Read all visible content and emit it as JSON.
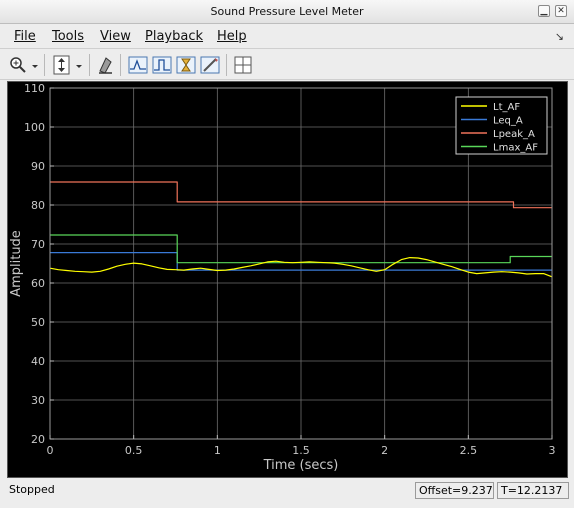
{
  "window": {
    "title": "Sound Pressure Level Meter"
  },
  "menu": [
    {
      "key": "file",
      "label": "File"
    },
    {
      "key": "tools",
      "label": "Tools"
    },
    {
      "key": "view",
      "label": "View"
    },
    {
      "key": "playback",
      "label": "Playback"
    },
    {
      "key": "help",
      "label": "Help"
    }
  ],
  "toolbar": {
    "icons": [
      "zoom-in-icon",
      "dropdown-arrow-icon",
      "autoscale-icon",
      "dropdown-arrow-icon",
      "highlight-icon",
      "triggers-icon",
      "peak-finder-icon",
      "bilevel-measurements-icon",
      "signal-statistics-icon",
      "legend-layout-icon"
    ]
  },
  "status": {
    "state": "Stopped",
    "offset": "Offset=9.237",
    "time": "T=12.2137"
  },
  "colors": {
    "background": "#000000",
    "grid": "#6e6e6e",
    "axis_text": "#c8c8c8",
    "Lt_AF": "#ffff00",
    "Leq_A": "#3a7ad6",
    "Lpeak_A": "#f0735a",
    "Lmax_AF": "#59d659"
  },
  "chart_data": {
    "type": "line",
    "xlabel": "Time (secs)",
    "ylabel": "Amplitude",
    "xlim": [
      0,
      3
    ],
    "ylim": [
      20,
      110
    ],
    "xticks": [
      "0",
      "0.5",
      "1",
      "1.5",
      "2",
      "2.5",
      "3"
    ],
    "yticks": [
      "20",
      "30",
      "40",
      "50",
      "60",
      "70",
      "80",
      "90",
      "100",
      "110"
    ],
    "grid": true,
    "legend_position": "top-right",
    "series": [
      {
        "name": "Lt_AF",
        "color": "#ffff00",
        "x": [
          0,
          0.05,
          0.1,
          0.15,
          0.2,
          0.25,
          0.3,
          0.35,
          0.4,
          0.45,
          0.5,
          0.55,
          0.6,
          0.65,
          0.7,
          0.75,
          0.8,
          0.85,
          0.9,
          0.95,
          1.0,
          1.05,
          1.1,
          1.15,
          1.2,
          1.25,
          1.3,
          1.35,
          1.4,
          1.45,
          1.5,
          1.55,
          1.6,
          1.65,
          1.7,
          1.75,
          1.8,
          1.85,
          1.9,
          1.95,
          2.0,
          2.05,
          2.1,
          2.15,
          2.2,
          2.25,
          2.3,
          2.35,
          2.4,
          2.45,
          2.5,
          2.55,
          2.6,
          2.65,
          2.7,
          2.75,
          2.8,
          2.85,
          2.9,
          2.95,
          3.0
        ],
        "y": [
          63.8,
          63.4,
          63.2,
          63.0,
          62.9,
          62.8,
          63.0,
          63.6,
          64.3,
          64.8,
          65.1,
          64.9,
          64.4,
          63.9,
          63.5,
          63.4,
          63.3,
          63.6,
          63.8,
          63.5,
          63.2,
          63.3,
          63.6,
          64.0,
          64.4,
          64.9,
          65.4,
          65.6,
          65.3,
          65.2,
          65.3,
          65.4,
          65.3,
          65.2,
          65.1,
          64.8,
          64.4,
          63.9,
          63.4,
          63.0,
          63.4,
          64.8,
          66.0,
          66.5,
          66.4,
          66.0,
          65.4,
          64.8,
          64.2,
          63.5,
          62.8,
          62.4,
          62.6,
          62.8,
          62.9,
          62.8,
          62.6,
          62.3,
          62.4,
          62.4,
          61.6
        ]
      },
      {
        "name": "Leq_A",
        "color": "#3a7ad6",
        "x": [
          0,
          0.76,
          0.76,
          2.7,
          2.7,
          3.0
        ],
        "y": [
          67.8,
          67.8,
          63.3,
          63.3,
          63.3,
          63.3
        ]
      },
      {
        "name": "Lpeak_A",
        "color": "#f0735a",
        "x": [
          0,
          0.76,
          0.76,
          2.77,
          2.77,
          3.0
        ],
        "y": [
          85.9,
          85.9,
          80.8,
          80.8,
          79.3,
          79.3
        ]
      },
      {
        "name": "Lmax_AF",
        "color": "#59d659",
        "x": [
          0,
          0.76,
          0.76,
          2.75,
          2.75,
          3.0
        ],
        "y": [
          72.3,
          72.3,
          65.2,
          65.2,
          66.8,
          66.8
        ]
      }
    ]
  }
}
